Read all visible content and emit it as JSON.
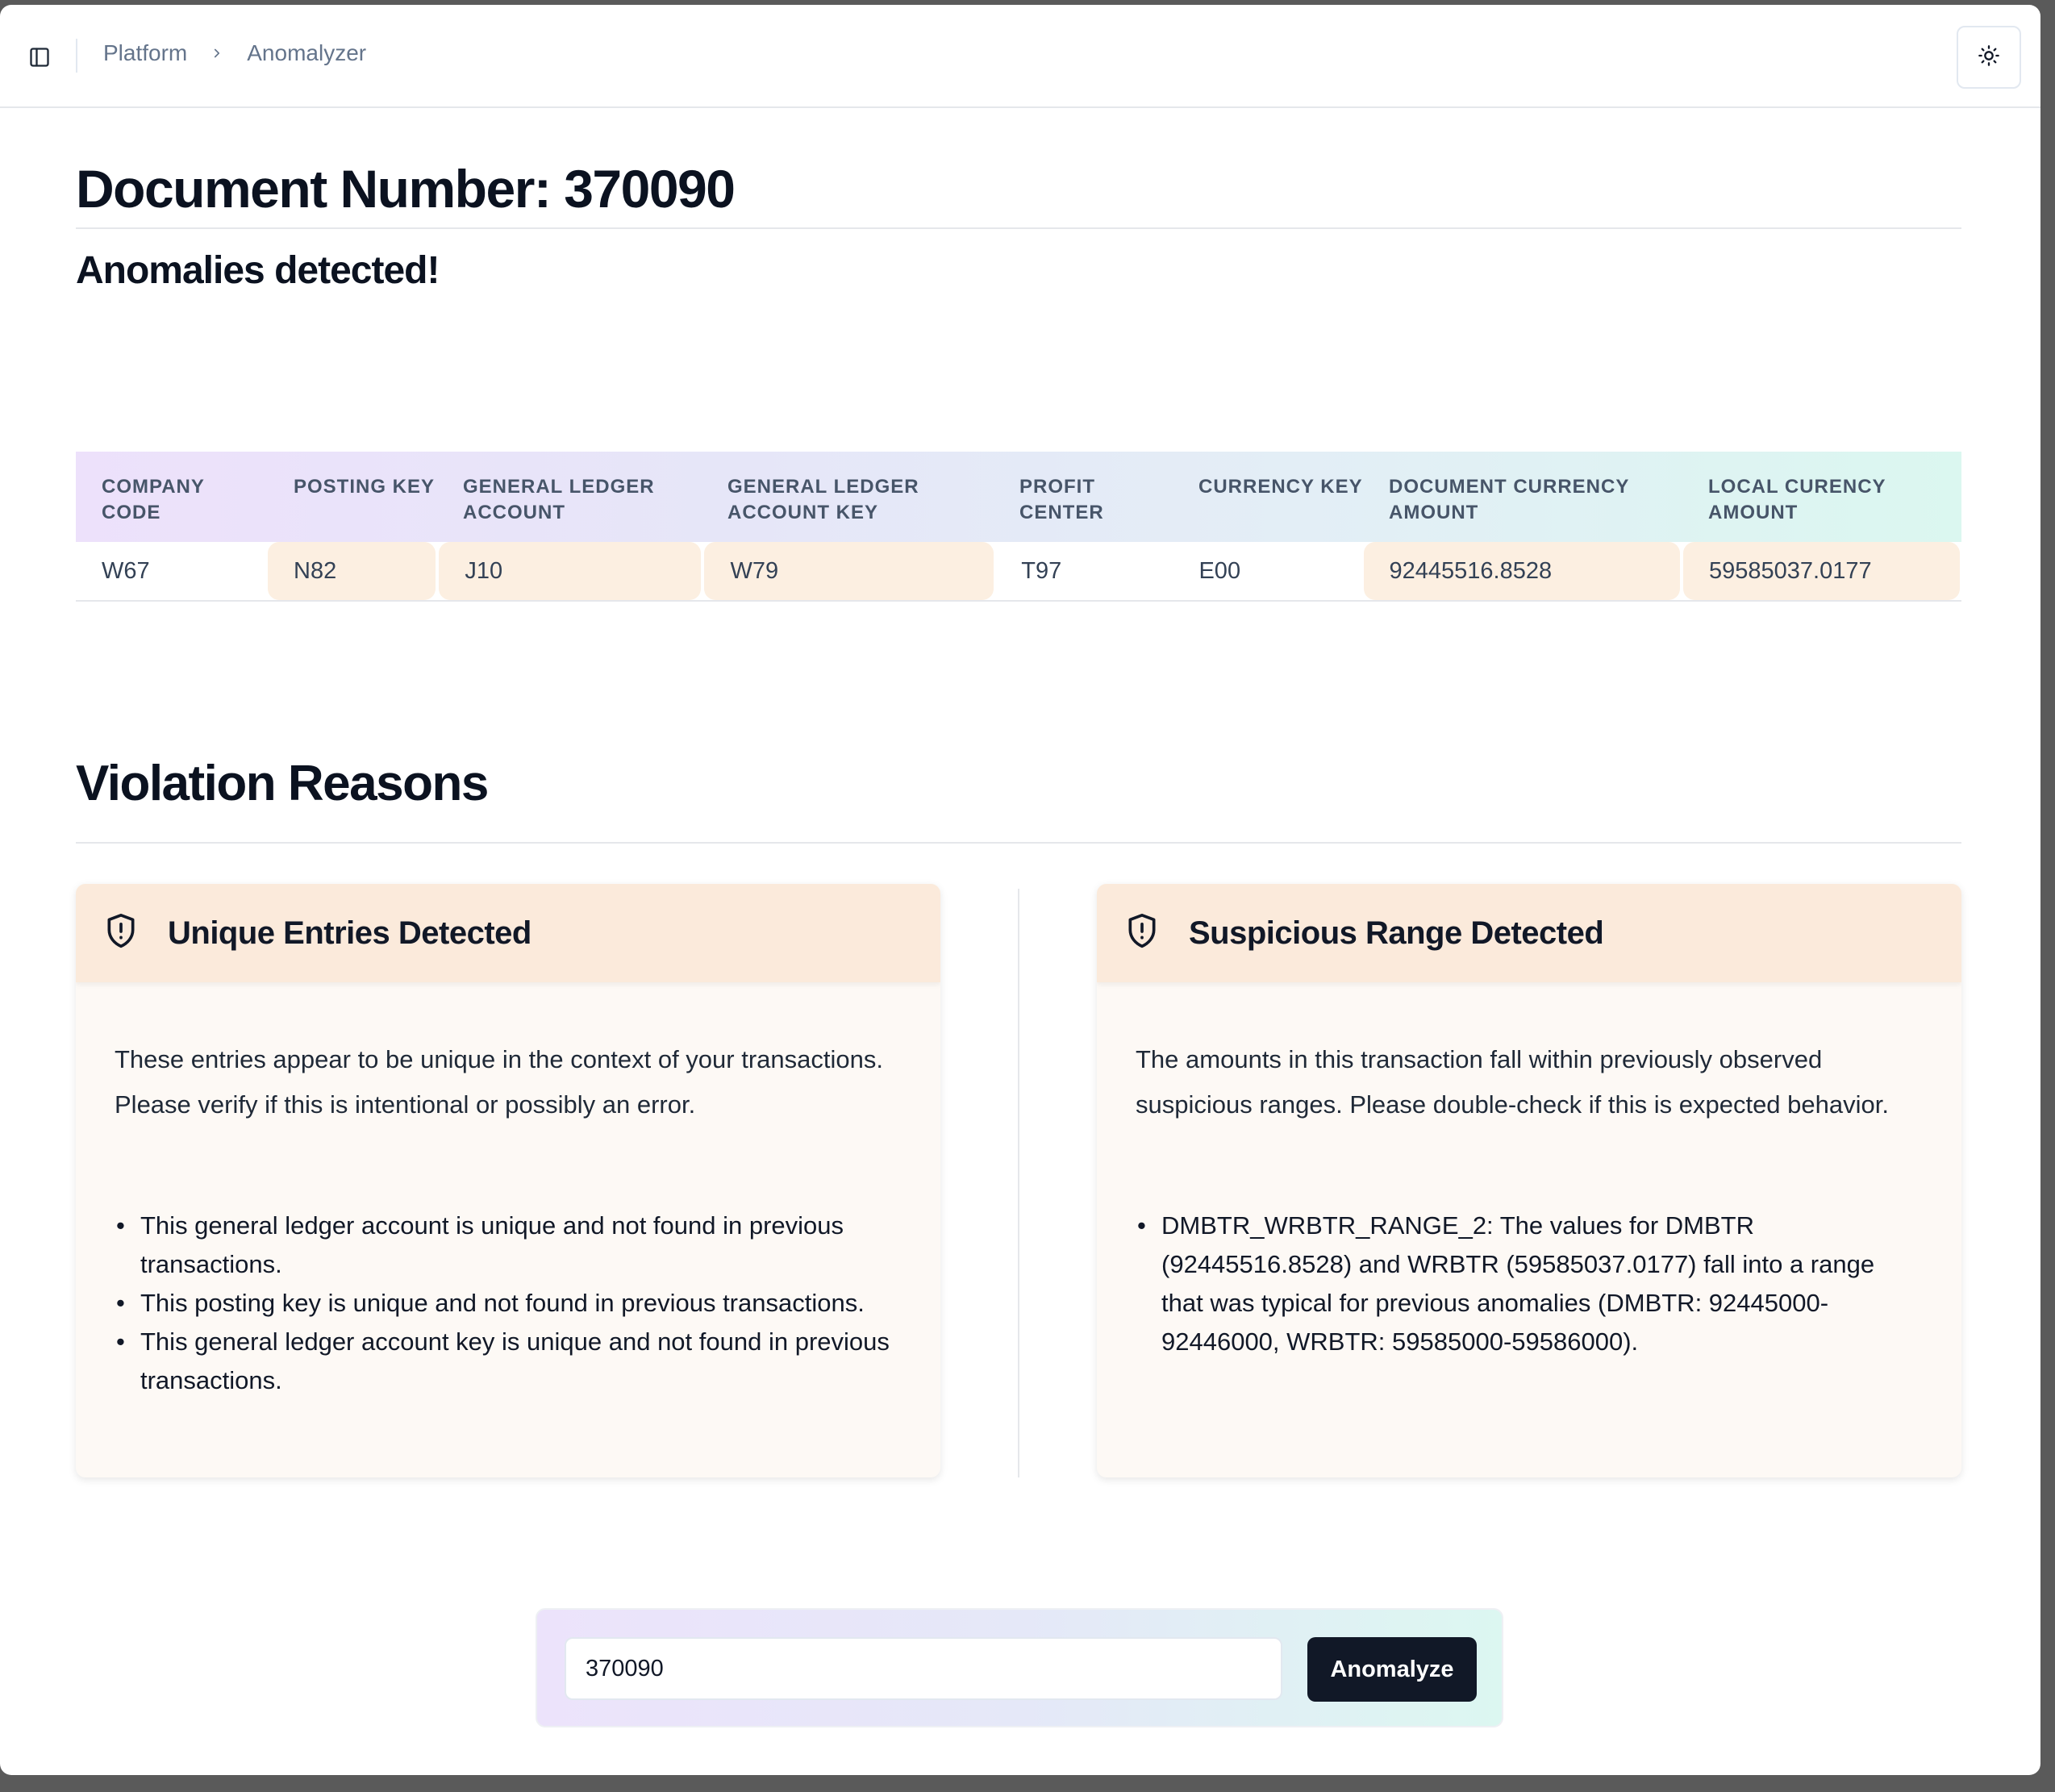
{
  "header": {
    "breadcrumb": [
      "Platform",
      "Anomalyzer"
    ],
    "sidebar_toggle_icon": "sidebar-panel-icon",
    "theme_toggle_icon": "sun-icon"
  },
  "page": {
    "title": "Document Number: 370090",
    "subtitle": "Anomalies detected!"
  },
  "table": {
    "columns": [
      "COMPANY CODE",
      "POSTING KEY",
      "GENERAL LEDGER ACCOUNT",
      "GENERAL LEDGER ACCOUNT KEY",
      "PROFIT CENTER",
      "CURRENCY KEY",
      "DOCUMENT CURRENCY AMOUNT",
      "LOCAL CURENCY AMOUNT"
    ],
    "rows": [
      {
        "cells": [
          "W67",
          "N82",
          "J10",
          "W79",
          "T97",
          "E00",
          "92445516.8528",
          "59585037.0177"
        ],
        "flagged": [
          false,
          true,
          true,
          true,
          false,
          false,
          true,
          true
        ]
      }
    ],
    "flag_color": "#fcefe1"
  },
  "violations": {
    "title": "Violation Reasons",
    "cards": [
      {
        "icon": "shield-alert-icon",
        "title": "Unique Entries Detected",
        "description": "These entries appear to be unique in the context of your transactions. Please verify if this is intentional or possibly an error.",
        "items": [
          "This general ledger account is unique and not found in previous transactions.",
          "This posting key is unique and not found in previous transactions.",
          "This general ledger account key is unique and not found in previous transactions."
        ]
      },
      {
        "icon": "shield-alert-icon",
        "title": "Suspicious Range Detected",
        "description": "The amounts in this transaction fall within previously observed suspicious ranges. Please double-check if this is expected behavior.",
        "items": [
          "DMBTR_WRBTR_RANGE_2: The values for DMBTR (92445516.8528) and WRBTR (59585037.0177) fall into a range that was typical for previous anomalies (DMBTR: 92445000-92446000, WRBTR: 59585000-59586000)."
        ]
      }
    ],
    "header_color": "#fbeadb",
    "card_color": "#fdf9f5"
  },
  "search": {
    "value": "370090",
    "button_label": "Anomalyze"
  }
}
